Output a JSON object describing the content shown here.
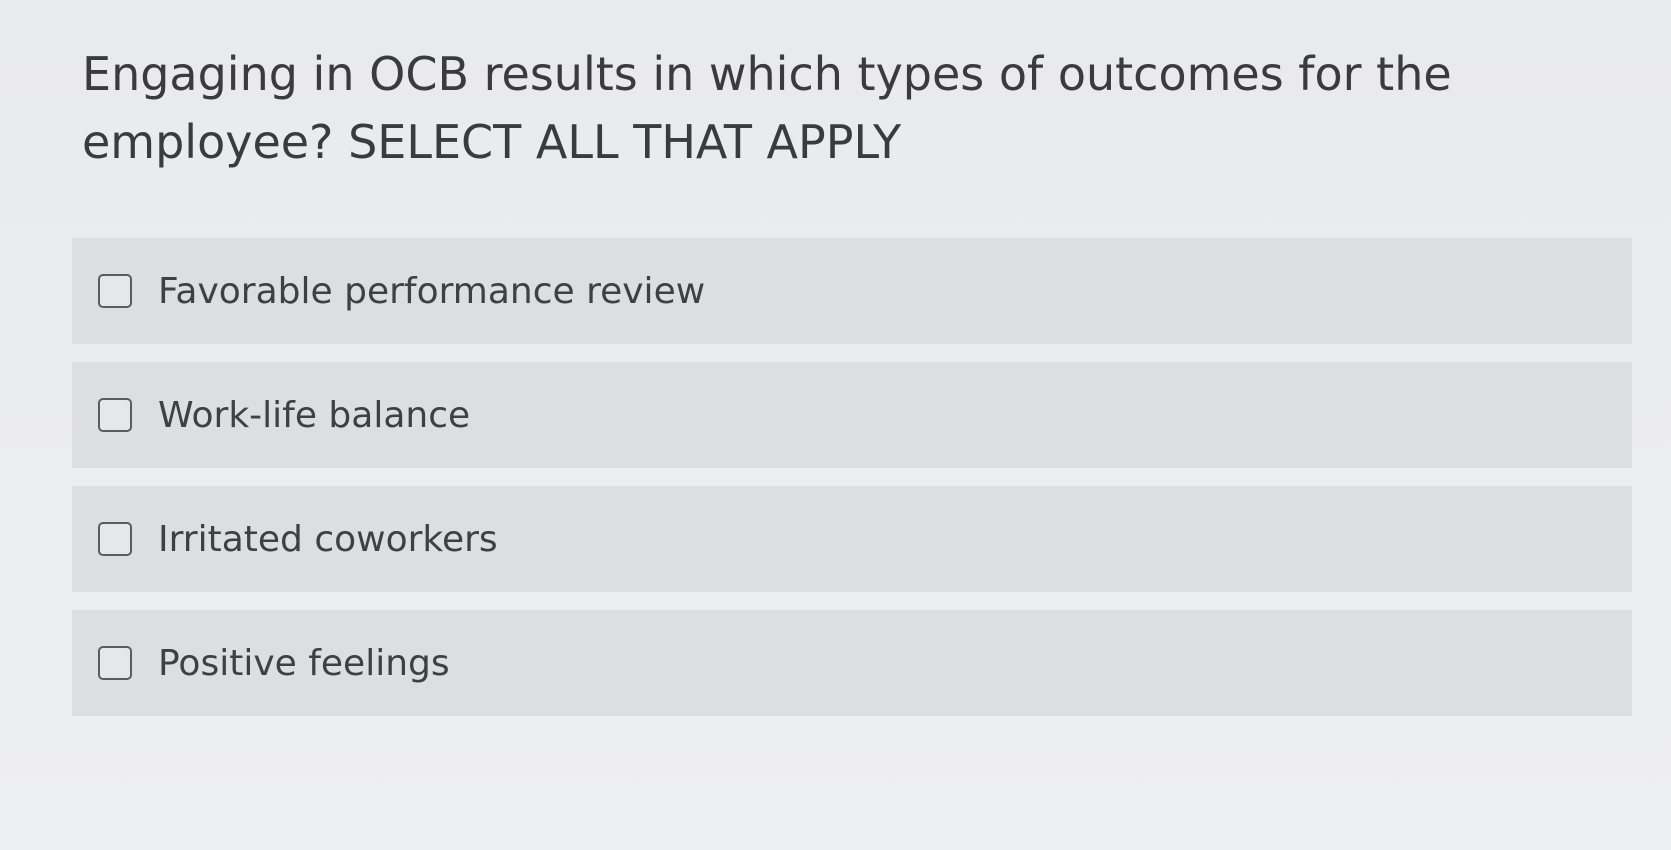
{
  "question": {
    "text": "Engaging in OCB results in which types of outcomes for the employee? SELECT ALL THAT APPLY"
  },
  "options": [
    {
      "label": "Favorable performance review",
      "checked": false
    },
    {
      "label": "Work-life balance",
      "checked": false
    },
    {
      "label": "Irritated coworkers",
      "checked": false
    },
    {
      "label": "Positive feelings",
      "checked": false
    }
  ],
  "colors": {
    "option_background": "#dcdee0",
    "page_background": "#ebecee",
    "text": "#3f4043"
  }
}
